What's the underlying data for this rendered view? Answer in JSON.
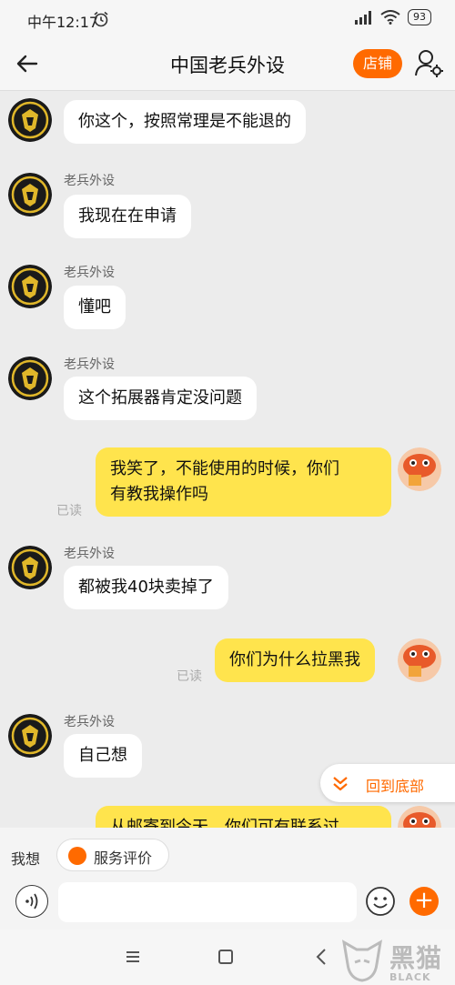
{
  "status": {
    "time": "中午12:17",
    "battery": "93"
  },
  "header": {
    "title": "中国老兵外设",
    "shop_label": "店铺"
  },
  "messages": [
    {
      "sender": "老兵外设",
      "text": "你这个，按照常理是不能退的"
    },
    {
      "sender": "老兵外设",
      "text": "我现在在申请"
    },
    {
      "sender": "老兵外设",
      "text": "懂吧"
    },
    {
      "sender": "老兵外设",
      "text": "这个拓展器肯定没问题"
    },
    {
      "text": "我笑了，不能使用的时候，你们",
      "text2": "有教我操作吗",
      "read": "已读"
    },
    {
      "sender": "老兵外设",
      "text": "都被我40块卖掉了"
    },
    {
      "text": "你们为什么拉黑我",
      "read": "已读"
    },
    {
      "sender": "老兵外设",
      "text": "自己想"
    },
    {
      "text": "从邮寄到今天，你们可有联系过"
    }
  ],
  "jump_to_bottom": "回到底部",
  "quick_bar": {
    "title": "我想",
    "rating": "服务评价"
  },
  "input": {
    "placeholder": ""
  },
  "watermark": {
    "text": "黑猫",
    "sub": "BLACK CAT"
  },
  "colors": {
    "accent": "#ff6a00",
    "out_bubble": "#ffe44d",
    "in_bubble": "#ffffff",
    "background": "#ececec"
  }
}
